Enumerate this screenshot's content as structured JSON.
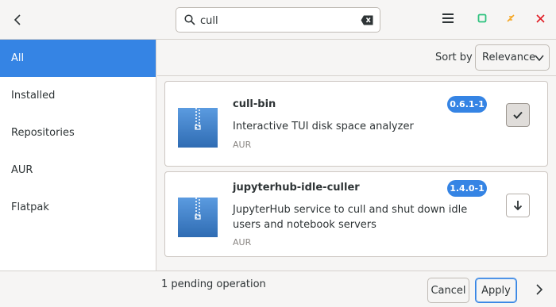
{
  "header": {
    "search_value": "cull",
    "icons": [
      "back-icon",
      "search-icon",
      "clear-icon",
      "menu-icon",
      "maximize-icon",
      "minimize-icon",
      "close-icon"
    ],
    "colors": {
      "maximize": "#2ec27e",
      "minimize": "#f5a623",
      "close": "#e01b24"
    }
  },
  "sidebar": {
    "items": [
      {
        "label": "All",
        "active": true
      },
      {
        "label": "Installed",
        "active": false
      },
      {
        "label": "Repositories",
        "active": false
      },
      {
        "label": "AUR",
        "active": false
      },
      {
        "label": "Flatpak",
        "active": false
      }
    ]
  },
  "sort": {
    "label": "Sort by",
    "selected": "Relevance"
  },
  "packages": [
    {
      "name": "cull-bin",
      "description": "Interactive TUI disk space analyzer",
      "repo": "AUR",
      "version": "0.6.1-1",
      "action_icon": "check-icon",
      "selected": true
    },
    {
      "name": "jupyterhub-idle-culler",
      "description": "JupyterHub service to cull and shut down idle users and notebook servers",
      "repo": "AUR",
      "version": "1.4.0-1",
      "action_icon": "download-icon",
      "selected": false
    }
  ],
  "footer": {
    "pending_text": "1 pending operation",
    "cancel_label": "Cancel",
    "apply_label": "Apply"
  },
  "accent_color": "#3584e4"
}
